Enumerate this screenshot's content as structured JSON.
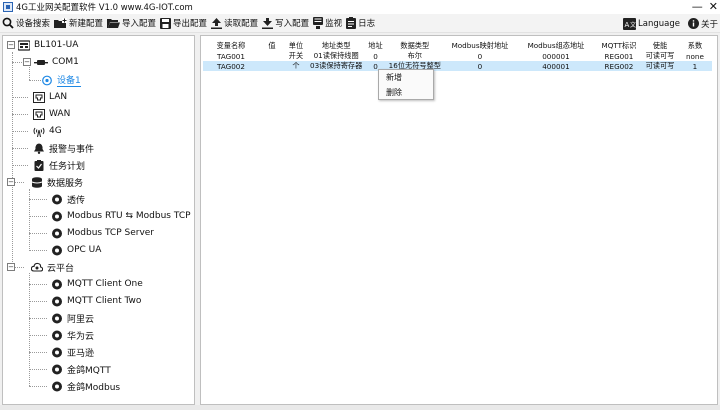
{
  "window": {
    "title": "4G工业网关配置软件 V1.0 www.4G-IOT.com",
    "minimize": "—",
    "close": "✕"
  },
  "toolbar": {
    "search": "设备搜索",
    "new_config": "新建配置",
    "import_config": "导入配置",
    "export_config": "导出配置",
    "read_config": "读取配置",
    "write_config": "写入配置",
    "monitor": "监视",
    "log": "日志",
    "language": "Language",
    "about": "关于"
  },
  "tree": {
    "root": "BL101-UA",
    "com1": "COM1",
    "device1": "设备1",
    "lan": "LAN",
    "wan": "WAN",
    "fourg": "4G",
    "alarm": "报警与事件",
    "task": "任务计划",
    "data_service": "数据服务",
    "transparent": "透传",
    "rtu_tcp": "Modbus RTU ⇆ Modbus TCP",
    "tcp_server": "Modbus TCP Server",
    "opc_ua": "OPC UA",
    "cloud": "云平台",
    "mqtt_one": "MQTT Client One",
    "mqtt_two": "MQTT Client Two",
    "aliyun": "阿里云",
    "huawei": "华为云",
    "amazon": "亚马逊",
    "jinge_mqtt": "金鸽MQTT",
    "jinge_modbus": "金鸽Modbus"
  },
  "table": {
    "headers": [
      "变量名称",
      "值",
      "单位",
      "地址类型",
      "地址",
      "数据类型",
      "Modbus映射地址",
      "Modbus组态地址",
      "MQTT标识",
      "使能",
      "系数"
    ],
    "rows": [
      [
        "TAG001",
        "",
        "开关",
        "01读保持线圈",
        "0",
        "布尔",
        "0",
        "000001",
        "REG001",
        "可读可写",
        "none"
      ],
      [
        "TAG002",
        "",
        "个",
        "03读保持寄存器",
        "0",
        "16位无符号整型",
        "0",
        "400001",
        "REG002",
        "可读可写",
        "1"
      ]
    ]
  },
  "context_menu": {
    "add": "新增",
    "delete": "删除"
  },
  "colors": {
    "selected_row": "#cde8fb",
    "selected_node": "#1e88e5"
  }
}
